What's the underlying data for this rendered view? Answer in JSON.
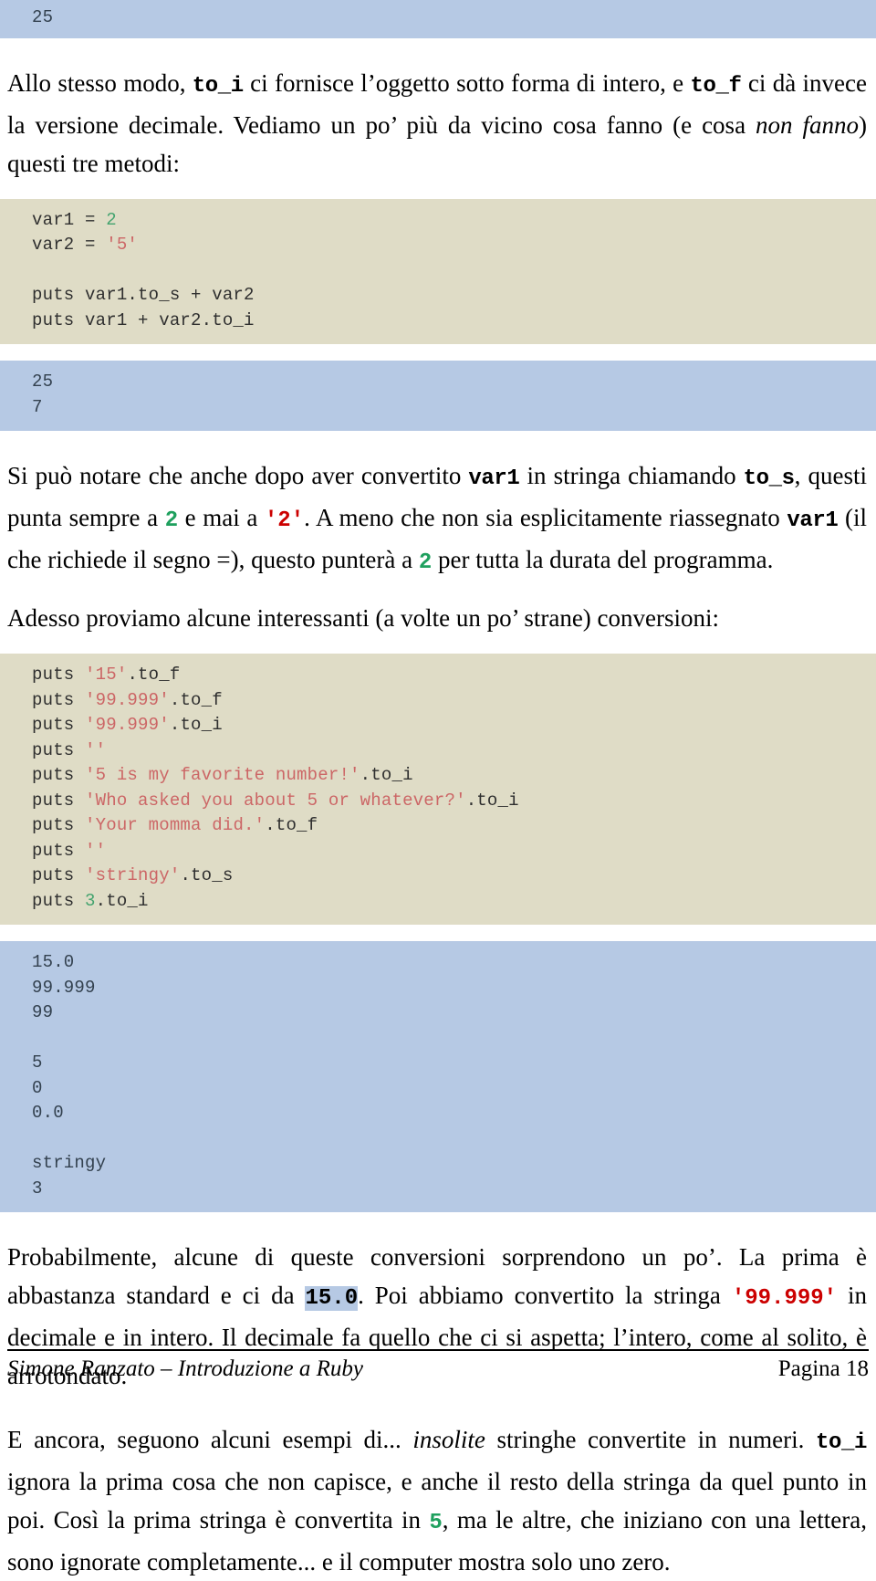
{
  "document": {
    "top_output": [
      "25"
    ],
    "paragraph_1": {
      "seg1": "Allo stesso modo, ",
      "code1": "to_i",
      "seg2": " ci fornisce l’oggetto sotto forma di intero, e ",
      "code2": "to_f",
      "seg3": " ci dà invece la versione decimale. Vediamo un po’ più da vicino cosa fanno (e cosa ",
      "italic1": "non fanno",
      "seg4": ") questi tre metodi:"
    },
    "code_block_1": [
      {
        "text": "var1 = ",
        "num": "2"
      },
      {
        "text": "var2 = ",
        "str": "'5'"
      },
      {
        "text": ""
      },
      {
        "text": "puts var1.to_s + var2"
      },
      {
        "text": "puts var1 + var2.to_i"
      }
    ],
    "output_block_1": [
      "25",
      "7"
    ],
    "paragraph_2": {
      "seg1": "Si può notare che anche dopo aver convertito ",
      "code1": "var1",
      "seg2": " in stringa chiamando ",
      "code2": "to_s",
      "seg3": ", questi punta sempre a ",
      "green1": "2",
      "seg4": " e mai a ",
      "red1": "'2'",
      "seg5": ". A meno che non sia esplicitamente riassegnato ",
      "code3": "var1",
      "seg6": " (il che richiede il segno =), questo punterà a ",
      "green2": "2",
      "seg7": " per tutta la durata del programma."
    },
    "paragraph_3": "Adesso proviamo alcune interessanti (a volte un po’ strane) conversioni:",
    "code_block_2": [
      {
        "pre": "puts ",
        "str": "'15'",
        "post": ".to_f"
      },
      {
        "pre": "puts ",
        "str": "'99.999'",
        "post": ".to_f"
      },
      {
        "pre": "puts ",
        "str": "'99.999'",
        "post": ".to_i"
      },
      {
        "pre": "puts ",
        "str": "''",
        "post": ""
      },
      {
        "pre": "puts ",
        "str": "'5 is my favorite number!'",
        "post": ".to_i"
      },
      {
        "pre": "puts ",
        "str": "'Who asked you about 5 or whatever?'",
        "post": ".to_i"
      },
      {
        "pre": "puts ",
        "str": "'Your momma did.'",
        "post": ".to_f"
      },
      {
        "pre": "puts ",
        "str": "''",
        "post": ""
      },
      {
        "pre": "puts ",
        "str": "'stringy'",
        "post": ".to_s"
      },
      {
        "pre": "puts ",
        "num": "3",
        "post": ".to_i"
      }
    ],
    "output_block_2": [
      "15.0",
      "99.999",
      "99",
      "",
      "5",
      "0",
      "0.0",
      "",
      "stringy",
      "3"
    ],
    "paragraph_4": {
      "seg1": "Probabilmente, alcune di queste conversioni sorprendono un po’. La prima è abbastanza standard e ci da ",
      "hl1": "15.0",
      "seg2": ". Poi abbiamo convertito la stringa ",
      "red1": "'99.999'",
      "seg3": " in decimale e in intero. Il decimale fa quello che ci si aspetta; l’intero, come al solito, è arrotondato."
    },
    "paragraph_5": {
      "seg1": "E ancora, seguono alcuni esempi di... ",
      "italic1": "insolite",
      "seg2": " stringhe convertite in numeri. ",
      "code1": "to_i",
      "seg3": " ignora la prima cosa che non capisce, e anche il resto della stringa da quel punto in poi. Così la prima stringa è convertita in ",
      "green1": "5",
      "seg4": ", ma le altre, che iniziano con una lettera, sono ignorate completamente... e il computer mostra solo uno zero."
    },
    "footer": {
      "left": "Simone Ranzato – Introduzione a Ruby",
      "right": "Pagina 18"
    },
    "colors": {
      "code_bg": "#dfdcc6",
      "output_bg": "#b6c9e4",
      "number_token": "#43a36e",
      "string_token": "#cc6666",
      "inline_green": "#1fa05e",
      "inline_red": "#cc0000"
    }
  }
}
